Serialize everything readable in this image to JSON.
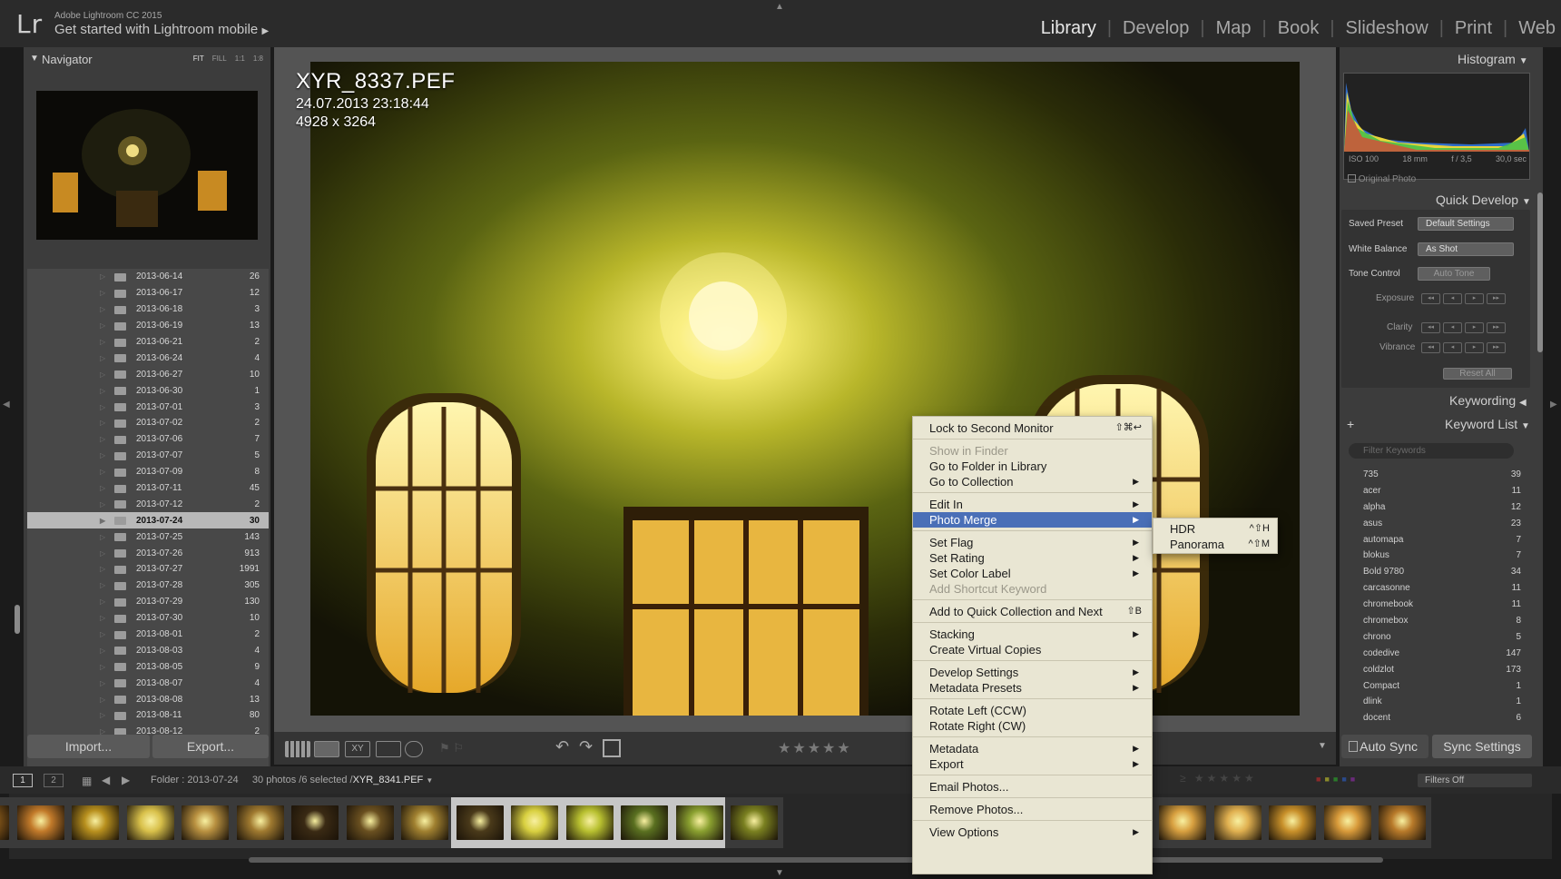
{
  "app": {
    "product": "Adobe Lightroom CC 2015",
    "mobile_prompt": "Get started with Lightroom mobile",
    "logo": "Lr"
  },
  "modules": [
    "Library",
    "Develop",
    "Map",
    "Book",
    "Slideshow",
    "Print",
    "Web"
  ],
  "active_module": "Library",
  "navigator": {
    "title": "Navigator",
    "zoom": [
      "FIT",
      "FILL",
      "1:1",
      "1:8"
    ]
  },
  "folders": [
    {
      "name": "2013-06-14",
      "count": "26"
    },
    {
      "name": "2013-06-17",
      "count": "12"
    },
    {
      "name": "2013-06-18",
      "count": "3"
    },
    {
      "name": "2013-06-19",
      "count": "13"
    },
    {
      "name": "2013-06-21",
      "count": "2"
    },
    {
      "name": "2013-06-24",
      "count": "4"
    },
    {
      "name": "2013-06-27",
      "count": "10"
    },
    {
      "name": "2013-06-30",
      "count": "1"
    },
    {
      "name": "2013-07-01",
      "count": "3"
    },
    {
      "name": "2013-07-02",
      "count": "2"
    },
    {
      "name": "2013-07-06",
      "count": "7"
    },
    {
      "name": "2013-07-07",
      "count": "5"
    },
    {
      "name": "2013-07-09",
      "count": "8"
    },
    {
      "name": "2013-07-11",
      "count": "45"
    },
    {
      "name": "2013-07-12",
      "count": "2"
    },
    {
      "name": "2013-07-24",
      "count": "30",
      "selected": true
    },
    {
      "name": "2013-07-25",
      "count": "143"
    },
    {
      "name": "2013-07-26",
      "count": "913"
    },
    {
      "name": "2013-07-27",
      "count": "1991"
    },
    {
      "name": "2013-07-28",
      "count": "305"
    },
    {
      "name": "2013-07-29",
      "count": "130"
    },
    {
      "name": "2013-07-30",
      "count": "10"
    },
    {
      "name": "2013-08-01",
      "count": "2"
    },
    {
      "name": "2013-08-03",
      "count": "4"
    },
    {
      "name": "2013-08-05",
      "count": "9"
    },
    {
      "name": "2013-08-07",
      "count": "4"
    },
    {
      "name": "2013-08-08",
      "count": "13"
    },
    {
      "name": "2013-08-11",
      "count": "80"
    },
    {
      "name": "2013-08-12",
      "count": "2"
    }
  ],
  "left_buttons": {
    "import": "Import...",
    "export": "Export..."
  },
  "photo_info": {
    "filename": "XYR_8337.PEF",
    "datetime": "24.07.2013 23:18:44",
    "dimensions": "4928 x 3264"
  },
  "histogram": {
    "title": "Histogram",
    "iso": "ISO 100",
    "focal": "18 mm",
    "aperture": "f / 3,5",
    "shutter": "30,0 sec",
    "original_photo": "Original Photo"
  },
  "quick_develop": {
    "title": "Quick Develop",
    "saved_preset_label": "Saved Preset",
    "saved_preset_value": "Default Settings",
    "white_balance_label": "White Balance",
    "white_balance_value": "As Shot",
    "tone_control_label": "Tone Control",
    "auto_tone": "Auto Tone",
    "exposure": "Exposure",
    "clarity": "Clarity",
    "vibrance": "Vibrance",
    "reset_all": "Reset All"
  },
  "keywording": {
    "title": "Keywording"
  },
  "keyword_list": {
    "title": "Keyword List",
    "filter_placeholder": "Filter Keywords",
    "items": [
      {
        "name": "735",
        "count": "39"
      },
      {
        "name": "acer",
        "count": "11"
      },
      {
        "name": "alpha",
        "count": "12"
      },
      {
        "name": "asus",
        "count": "23"
      },
      {
        "name": "automapa",
        "count": "7"
      },
      {
        "name": "blokus",
        "count": "7"
      },
      {
        "name": "Bold 9780",
        "count": "34"
      },
      {
        "name": "carcasonne",
        "count": "11"
      },
      {
        "name": "chromebook",
        "count": "11"
      },
      {
        "name": "chromebox",
        "count": "8"
      },
      {
        "name": "chrono",
        "count": "5"
      },
      {
        "name": "codedive",
        "count": "147"
      },
      {
        "name": "coldzlot",
        "count": "173"
      },
      {
        "name": "Compact",
        "count": "1"
      },
      {
        "name": "dlink",
        "count": "1"
      },
      {
        "name": "docent",
        "count": "6"
      }
    ]
  },
  "sync": {
    "auto_sync": "Auto Sync",
    "sync_settings": "Sync Settings"
  },
  "filmstrip": {
    "page1": "1",
    "page2": "2",
    "folder_prefix": "Folder : 2013-07-24",
    "count_text": "30 photos /6 selected /",
    "current_file": "XYR_8341.PEF",
    "filters": "Filters Off"
  },
  "context_menu": {
    "items": [
      {
        "label": "Lock to Second Monitor",
        "shortcut": "⇧⌘↩"
      },
      {
        "label": "Show in Finder",
        "disabled": true
      },
      {
        "label": "Go to Folder in Library"
      },
      {
        "label": "Go to Collection",
        "submenu": true
      },
      {
        "label": "Edit In",
        "submenu": true
      },
      {
        "label": "Photo Merge",
        "submenu": true,
        "highlighted": true
      },
      {
        "label": "Set Flag",
        "submenu": true
      },
      {
        "label": "Set Rating",
        "submenu": true
      },
      {
        "label": "Set Color Label",
        "submenu": true
      },
      {
        "label": "Add Shortcut Keyword",
        "disabled": true
      },
      {
        "label": "Add to Quick Collection and Next",
        "shortcut": "⇧B"
      },
      {
        "label": "Stacking",
        "submenu": true
      },
      {
        "label": "Create Virtual Copies"
      },
      {
        "label": "Develop Settings",
        "submenu": true
      },
      {
        "label": "Metadata Presets",
        "submenu": true
      },
      {
        "label": "Rotate Left (CCW)"
      },
      {
        "label": "Rotate Right (CW)"
      },
      {
        "label": "Metadata",
        "submenu": true
      },
      {
        "label": "Export",
        "submenu": true
      },
      {
        "label": "Email Photos..."
      },
      {
        "label": "Remove Photos..."
      },
      {
        "label": "View Options",
        "submenu": true
      }
    ],
    "submenu": [
      {
        "label": "HDR",
        "shortcut": "^⇧H"
      },
      {
        "label": "Panorama",
        "shortcut": "^⇧M"
      }
    ]
  },
  "colors": {
    "menu_bg": "#e9e6d3",
    "menu_highlight": "#4a6fb7",
    "panel_bg": "#3c3c3c",
    "center_bg": "#545454"
  }
}
